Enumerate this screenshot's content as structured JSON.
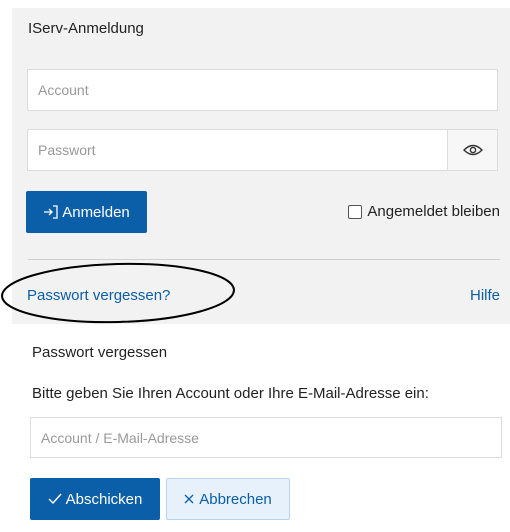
{
  "login": {
    "title": "IServ-Anmeldung",
    "account_placeholder": "Account",
    "password_placeholder": "Passwort",
    "toggle_icon": "eye-icon",
    "login_label": "Anmelden",
    "login_icon": "sign-in-icon",
    "remember_label": "Angemeldet bleiben",
    "remember_checked": false,
    "forgot_link": "Passwort vergessen?",
    "help_link": "Hilfe"
  },
  "forgot": {
    "title": "Passwort vergessen",
    "instruction": "Bitte geben Sie Ihren Account oder Ihre E-Mail-Adresse ein:",
    "email_placeholder": "Account / E-Mail-Adresse",
    "submit_label": "Abschicken",
    "submit_icon": "check-icon",
    "cancel_label": "Abbrechen",
    "cancel_icon": "close-icon"
  },
  "colors": {
    "primary": "#0b5ea8",
    "panel_background": "#f2f2f2",
    "cancel_background": "#e7f1fb"
  }
}
